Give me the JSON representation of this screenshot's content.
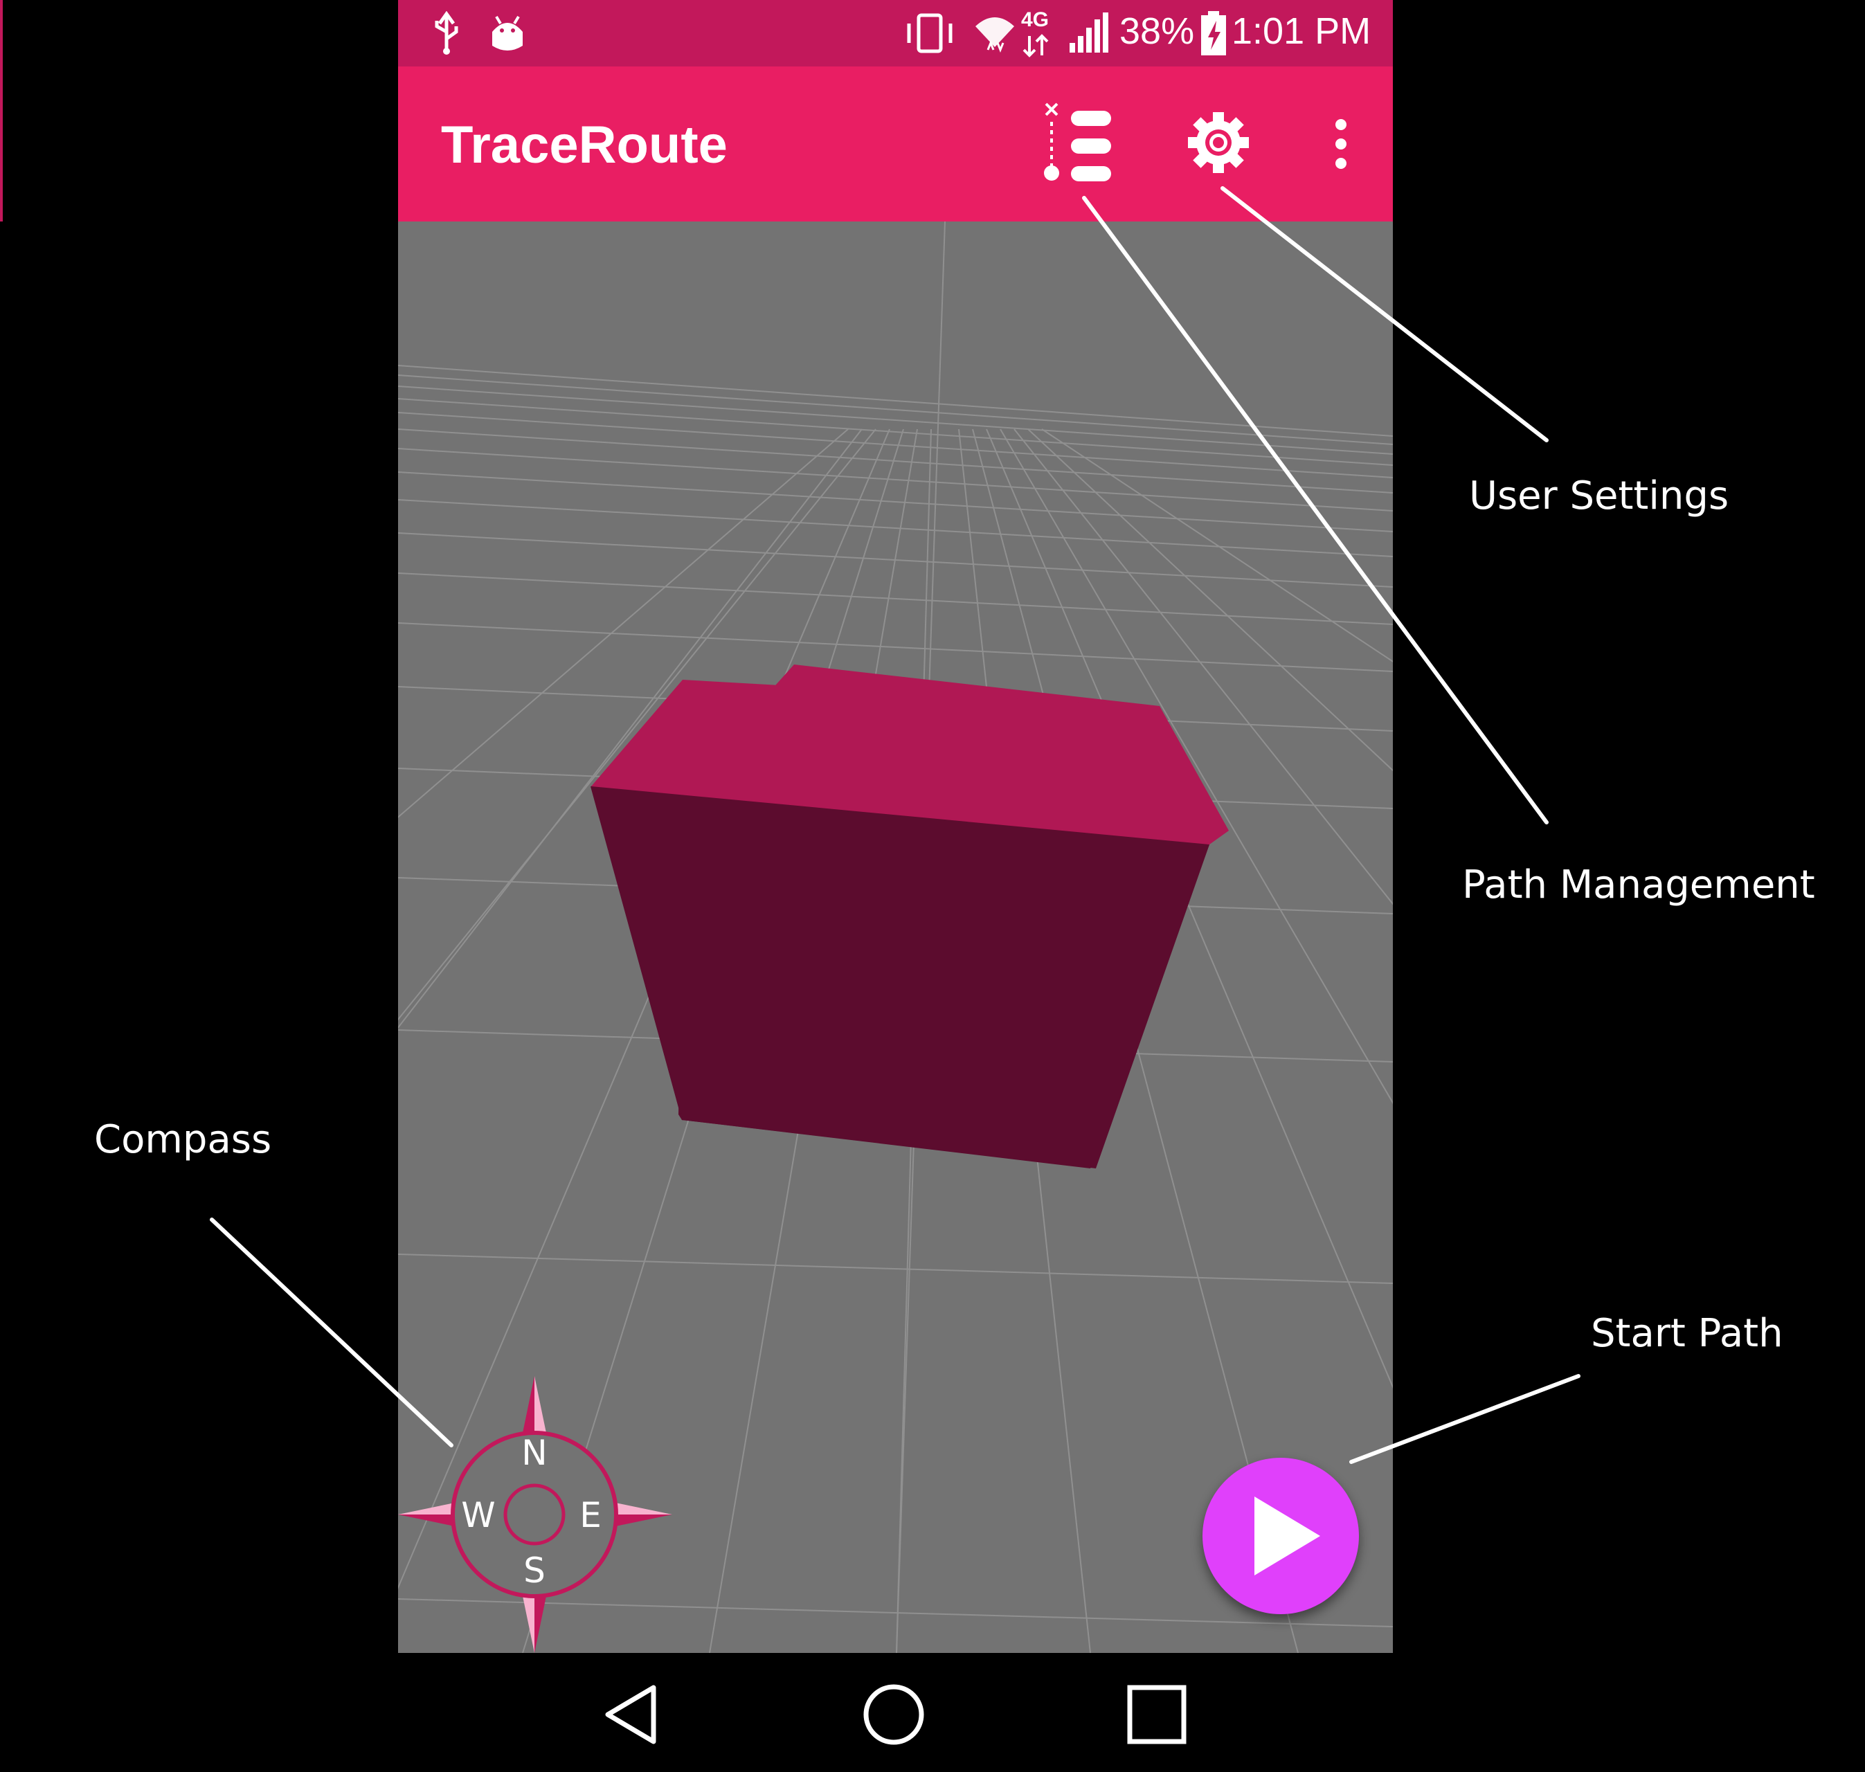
{
  "status_bar": {
    "battery": "38%",
    "time": "1:01 PM",
    "network": "4G",
    "icons": [
      "usb-icon",
      "android-debug-icon",
      "vibrate-icon",
      "wifi-icon",
      "lte-icon",
      "signal-icon",
      "battery-charging-icon"
    ]
  },
  "app_bar": {
    "title": "TraceRoute",
    "actions": [
      "path-management-icon",
      "settings-gear-icon",
      "overflow-menu-icon"
    ]
  },
  "compass": {
    "north": "N",
    "east": "E",
    "south": "S",
    "west": "W"
  },
  "annotations": {
    "user_settings": "User Settings",
    "path_management": "Path Management",
    "compass": "Compass",
    "start_path": "Start Path"
  },
  "colors": {
    "status_bar": "#c2185b",
    "app_bar": "#e91e63",
    "fab": "#e040fb",
    "viewport": "#737373",
    "cube_top": "#b01854",
    "cube_front": "#5c0c2e"
  },
  "nav_bar": [
    "back-icon",
    "home-icon",
    "recents-icon"
  ]
}
